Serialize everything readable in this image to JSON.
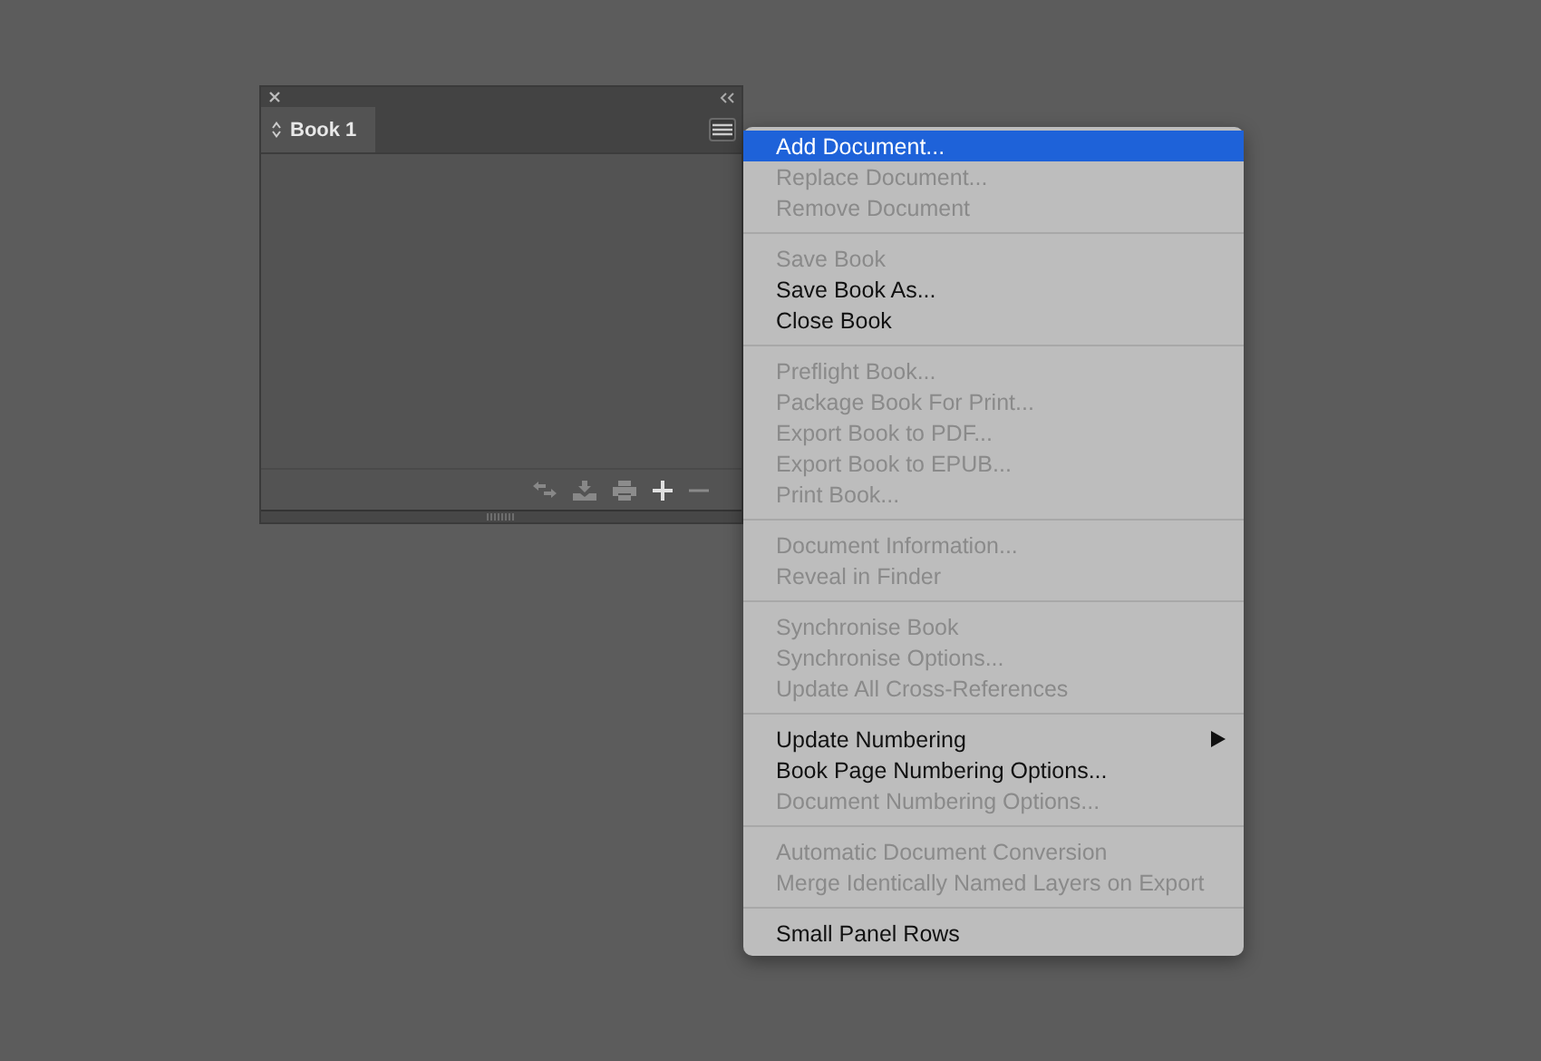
{
  "panel": {
    "tabs": [
      {
        "label": "Book 1",
        "selected": true
      }
    ]
  },
  "menu": {
    "groups": [
      {
        "items": [
          {
            "label": "Add Document...",
            "selected": true,
            "disabled": false,
            "submenu": false
          },
          {
            "label": "Replace Document...",
            "selected": false,
            "disabled": true,
            "submenu": false
          },
          {
            "label": "Remove Document",
            "selected": false,
            "disabled": true,
            "submenu": false
          }
        ]
      },
      {
        "items": [
          {
            "label": "Save Book",
            "selected": false,
            "disabled": true,
            "submenu": false
          },
          {
            "label": "Save Book As...",
            "selected": false,
            "disabled": false,
            "submenu": false
          },
          {
            "label": "Close Book",
            "selected": false,
            "disabled": false,
            "submenu": false
          }
        ]
      },
      {
        "items": [
          {
            "label": "Preflight Book...",
            "selected": false,
            "disabled": true,
            "submenu": false
          },
          {
            "label": "Package Book For Print...",
            "selected": false,
            "disabled": true,
            "submenu": false
          },
          {
            "label": "Export Book to PDF...",
            "selected": false,
            "disabled": true,
            "submenu": false
          },
          {
            "label": "Export Book to EPUB...",
            "selected": false,
            "disabled": true,
            "submenu": false
          },
          {
            "label": "Print Book...",
            "selected": false,
            "disabled": true,
            "submenu": false
          }
        ]
      },
      {
        "items": [
          {
            "label": "Document Information...",
            "selected": false,
            "disabled": true,
            "submenu": false
          },
          {
            "label": "Reveal in Finder",
            "selected": false,
            "disabled": true,
            "submenu": false
          }
        ]
      },
      {
        "items": [
          {
            "label": "Synchronise Book",
            "selected": false,
            "disabled": true,
            "submenu": false
          },
          {
            "label": "Synchronise Options...",
            "selected": false,
            "disabled": true,
            "submenu": false
          },
          {
            "label": "Update All Cross-References",
            "selected": false,
            "disabled": true,
            "submenu": false
          }
        ]
      },
      {
        "items": [
          {
            "label": "Update Numbering",
            "selected": false,
            "disabled": false,
            "submenu": true
          },
          {
            "label": "Book Page Numbering Options...",
            "selected": false,
            "disabled": false,
            "submenu": false
          },
          {
            "label": "Document Numbering Options...",
            "selected": false,
            "disabled": true,
            "submenu": false
          }
        ]
      },
      {
        "items": [
          {
            "label": "Automatic Document Conversion",
            "selected": false,
            "disabled": true,
            "submenu": false
          },
          {
            "label": "Merge Identically Named Layers on Export",
            "selected": false,
            "disabled": true,
            "submenu": false
          }
        ]
      },
      {
        "items": [
          {
            "label": "Small Panel Rows",
            "selected": false,
            "disabled": false,
            "submenu": false
          }
        ]
      }
    ]
  }
}
